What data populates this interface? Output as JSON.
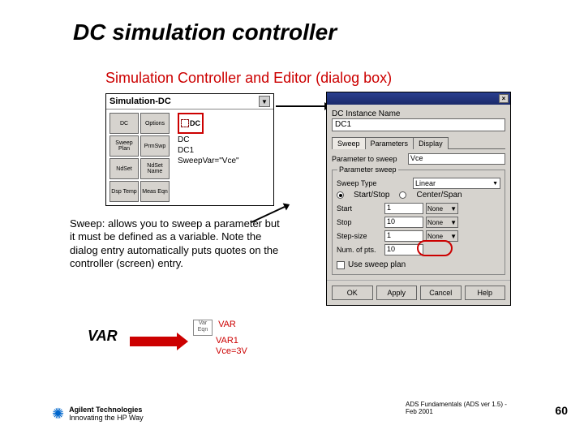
{
  "title": "DC simulation controller",
  "subtitle": "Simulation Controller and Editor (dialog box)",
  "palette": {
    "header": "Simulation-DC",
    "buttons_col1": [
      "DC",
      "Sweep Plan",
      "NdSet",
      "Dsp Temp"
    ],
    "buttons_col2": [
      "Options",
      "PrmSwp",
      "NdSet Name",
      "Meas Eqn"
    ],
    "dc_icon_label": "DC",
    "dc_lines": [
      "DC",
      "DC1",
      "SweepVar=\"Vce\""
    ]
  },
  "dialog": {
    "instance_label": "DC Instance Name",
    "instance_value": "DC1",
    "tabs": [
      "Sweep",
      "Parameters",
      "Display"
    ],
    "param_label": "Parameter to sweep",
    "param_value": "Vce",
    "sweep_legend": "Parameter sweep",
    "sweep_type_label": "Sweep Type",
    "sweep_type_value": "Linear",
    "radio1": "Start/Stop",
    "radio2": "Center/Span",
    "rows": {
      "start": {
        "label": "Start",
        "value": "1",
        "unit": "None"
      },
      "stop": {
        "label": "Stop",
        "value": "10",
        "unit": "None"
      },
      "step": {
        "label": "Step-size",
        "value": "1",
        "unit": "None"
      },
      "npts": {
        "label": "Num. of pts.",
        "value": "10"
      }
    },
    "use_sweep_plan": "Use sweep plan",
    "buttons": {
      "ok": "OK",
      "apply": "Apply",
      "cancel": "Cancel",
      "help": "Help"
    }
  },
  "sweep_text": "Sweep: allows you to sweep a parameter but it must be defined as a variable. Note the dialog entry automatically puts quotes on the controller (screen) entry.",
  "var": {
    "label": "VAR",
    "box": "Var Eqn",
    "lines": [
      "VAR",
      "VAR1",
      "Vce=3V"
    ]
  },
  "footer": {
    "company": "Agilent Technologies",
    "tag": "Innovating the HP Way",
    "right": "ADS Fundamentals (ADS ver 1.5) - Feb 2001",
    "page": "60"
  }
}
